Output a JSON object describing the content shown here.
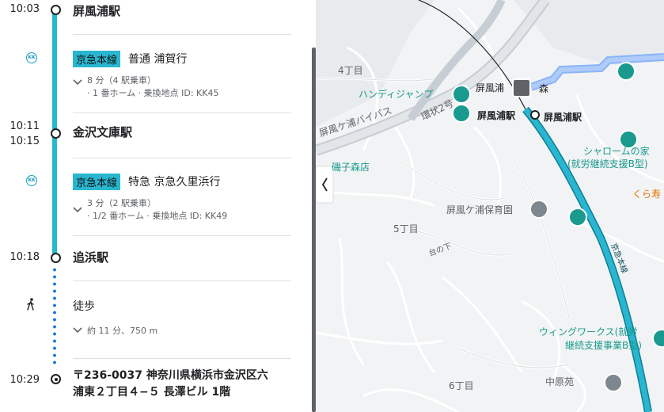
{
  "times": {
    "t1": "10:03",
    "t2a": "10:11",
    "t2b": "10:15",
    "t3": "10:18",
    "t4": "10:29"
  },
  "stations": {
    "s1": "屏風浦駅",
    "s2": "金沢文庫駅",
    "s3": "追浜駅"
  },
  "leg1": {
    "icon": "KK",
    "line": "京急本線",
    "service": "普通 浦賀行",
    "duration": "8 分（4 駅乗車）",
    "detail": "· 1 番ホーム · 乗換地点 ID: KK45"
  },
  "leg2": {
    "icon": "KK",
    "line": "京急本線",
    "service": "特急 京急久里浜行",
    "duration": "3 分（2 駅乗車）",
    "detail": "· 1/2 番ホーム · 乗換地点 ID: KK49"
  },
  "walk": {
    "label": "徒歩",
    "detail": "約 11 分、750 m"
  },
  "destination": {
    "line1": "〒236-0037 神奈川県横浜市金沢区六",
    "line2": "浦東２丁目４−５ 長澤ビル 1階"
  },
  "map": {
    "labels": {
      "l4chome": "4丁目",
      "handy": "ハンディジャンプ",
      "byobu_station_top": "屏風浦",
      "byobu_station_a": "屏風浦駅",
      "byobu_station_b": "屏風浦駅",
      "bypass": "屏風ケ浦バイパス",
      "kanjo": "環状2号",
      "isogo": "磯子森店",
      "mori": "森",
      "shalom1": "シャロームの家",
      "shalom2": "(就労継続支援B型)",
      "kura": "くら寿",
      "hoikuen": "屏風ケ浦保育園",
      "l5chome": "5丁目",
      "daishita": "台の下",
      "wing1": "ウィングワークス(就労",
      "wing2": "継続支援事業B型)",
      "l6chome": "6丁目",
      "nakahara": "中原苑",
      "rail": "京急本線"
    },
    "collapse_icon": "chevron-left-icon"
  },
  "colors": {
    "line": "#29b6d0",
    "rail": "#29b6d0",
    "poi": "#1a9a8e",
    "highlight": "#8ab4f8"
  }
}
